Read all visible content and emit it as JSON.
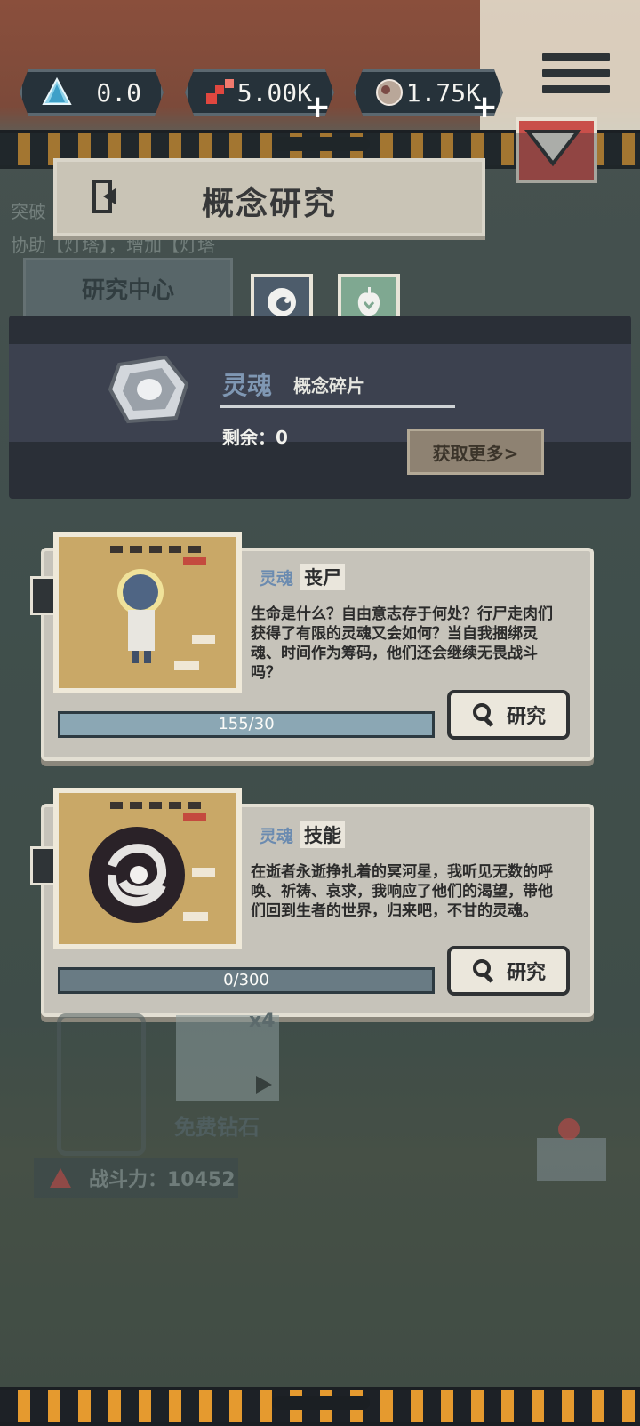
{
  "resources": [
    {
      "icon": "crystal-icon",
      "value": "0.0"
    },
    {
      "icon": "gem-cluster-icon",
      "value": "5.00K",
      "plus": "+"
    },
    {
      "icon": "ore-icon",
      "value": "1.75K",
      "plus": "+"
    }
  ],
  "page_title": "概念研究",
  "background": {
    "faded_line1": "突破",
    "faded_line2": "协助【灯塔】，增加【灯塔",
    "research_center": "研究中心",
    "free_diamond": "免费钻石",
    "multiplier": "x4",
    "power_label": "战斗力：10452"
  },
  "soul_panel": {
    "name": "灵魂",
    "type": "概念碎片",
    "remaining_label": "剩余：0",
    "more_button": "获取更多>"
  },
  "cards": [
    {
      "tag": "灵魂",
      "type": "丧尸",
      "description": "生命是什么？自由意志存于何处？行尸走肉们获得了有限的灵魂又会如何？当自我捆绑灵魂、时间作为筹码，他们还会继续无畏战斗吗？",
      "progress_label": "155/30",
      "progress_fraction": 1.0,
      "button": "研究"
    },
    {
      "tag": "灵魂",
      "type": "技能",
      "description": "在逝者永逝挣扎着的冥河星，我听见无数的呼唤、祈祷、哀求，我响应了他们的渴望，带他们回到生者的世界，归来吧，不甘的灵魂。",
      "progress_label": "0/300",
      "progress_fraction": 0.0,
      "button": "研究"
    }
  ],
  "colors": {
    "accent_red": "#c94f4a",
    "soul_blue": "#7f97b3",
    "hazard_orange": "#e59a2f"
  }
}
